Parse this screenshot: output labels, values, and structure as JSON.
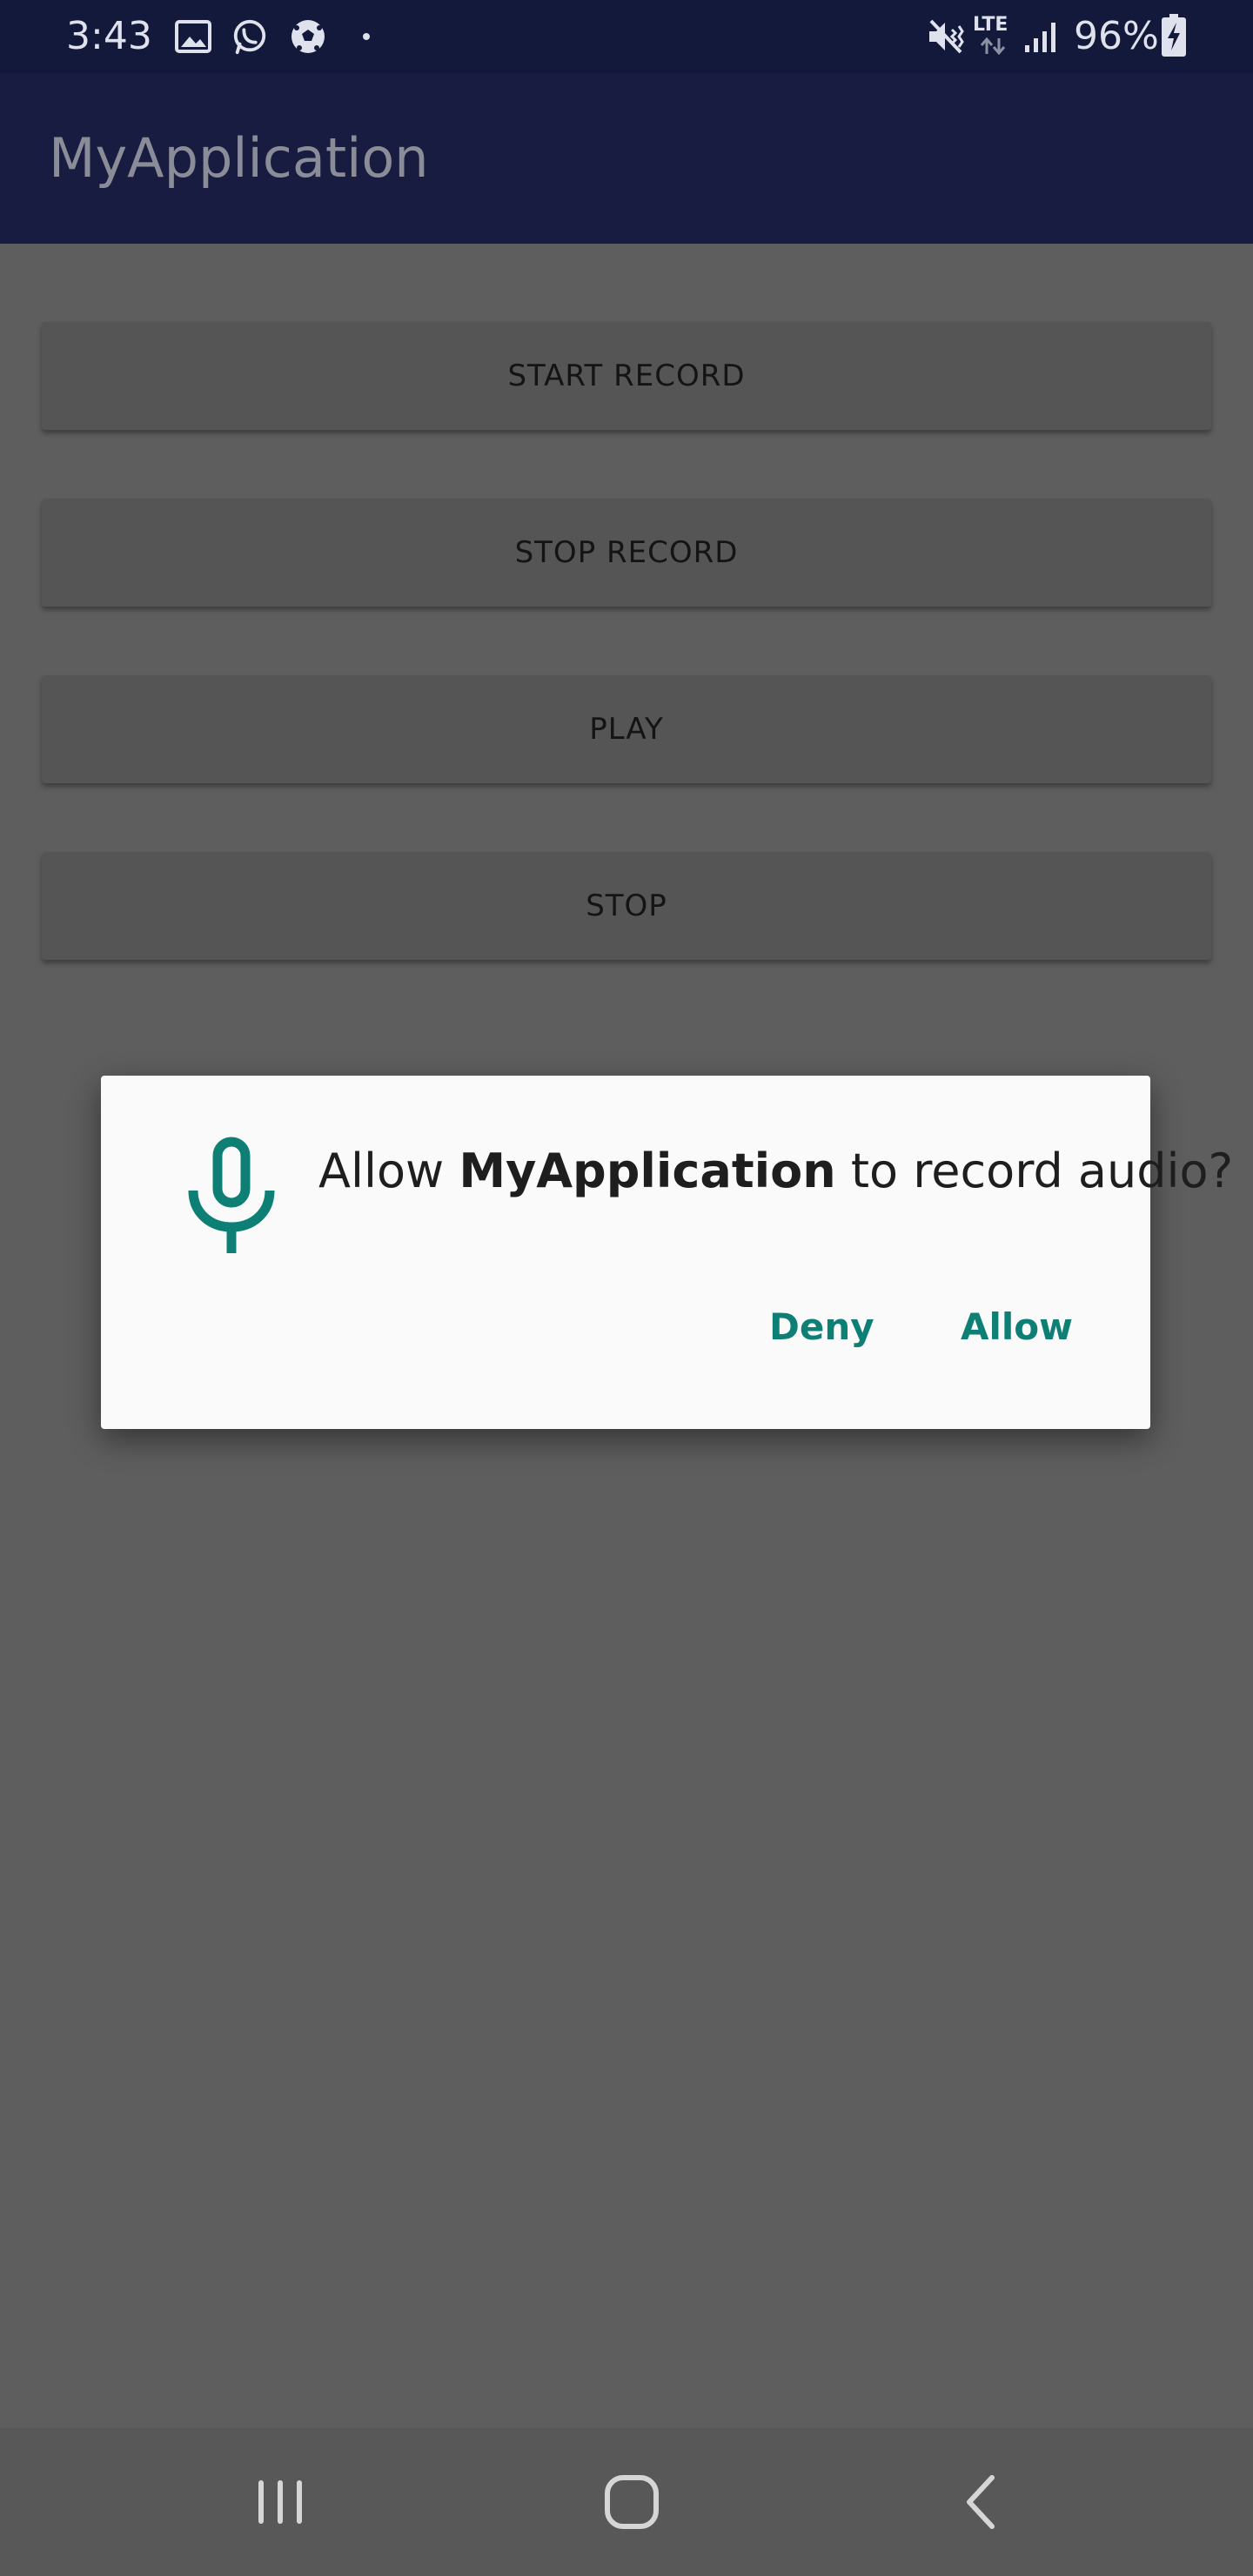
{
  "status_bar": {
    "time": "3:43",
    "network_type": "LTE",
    "battery_percent": "96%",
    "icons": [
      "gallery-icon",
      "whatsapp-icon",
      "soccer-ball-icon",
      "dot-icon",
      "mute-vibrate-icon",
      "lte-icon",
      "signal-icon",
      "battery-charging-icon"
    ]
  },
  "app_bar": {
    "title": "MyApplication"
  },
  "buttons": {
    "start_record": "START RECORD",
    "stop_record": "STOP RECORD",
    "play": "PLAY",
    "stop": "STOP"
  },
  "dialog": {
    "icon": "microphone-icon",
    "message_prefix": "Allow ",
    "message_app": "MyApplication",
    "message_suffix": " to record audio?",
    "deny_label": "Deny",
    "allow_label": "Allow",
    "accent_color": "#0d7f75"
  },
  "nav_bar": {
    "icons": [
      "recent-apps-icon",
      "home-icon",
      "back-icon"
    ]
  }
}
